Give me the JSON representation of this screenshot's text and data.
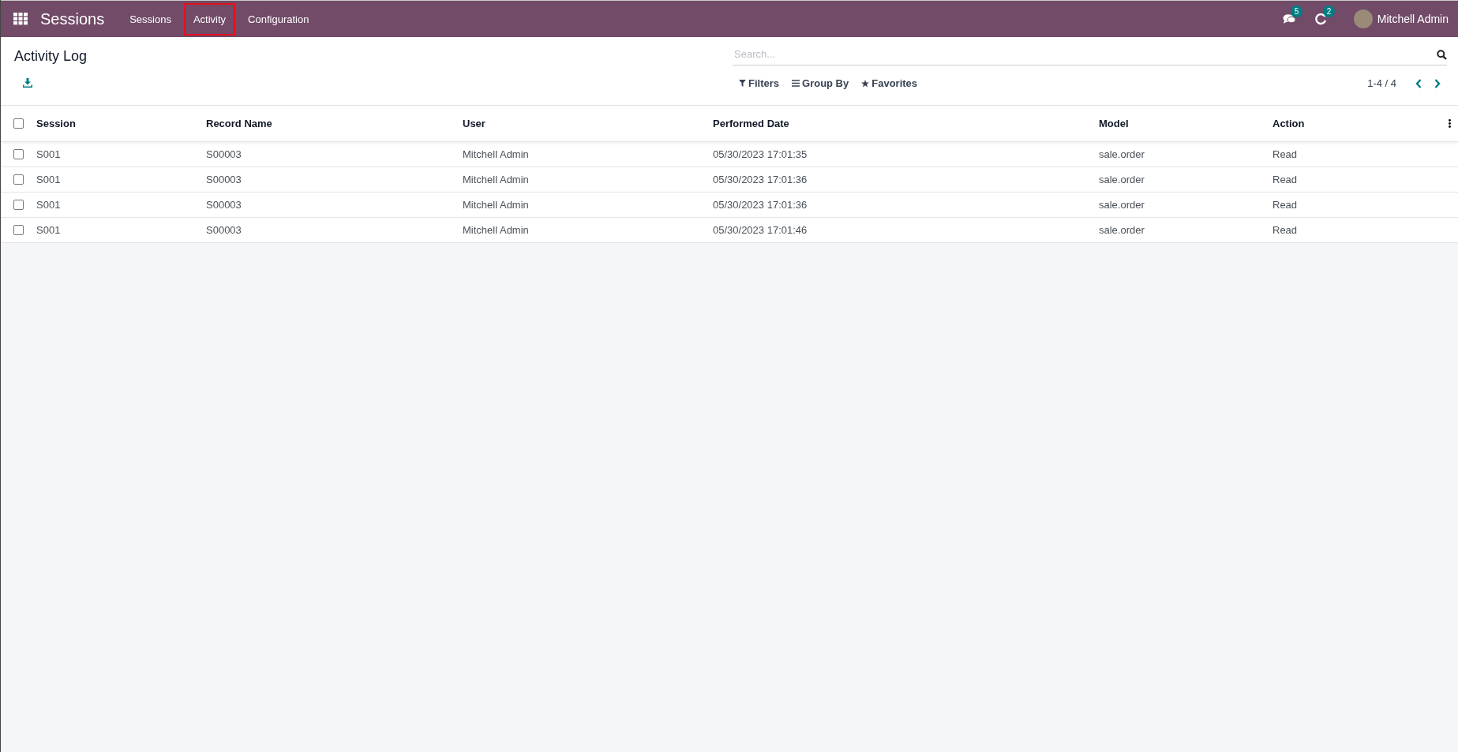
{
  "app_title": "Sessions",
  "menu": [
    {
      "label": "Sessions",
      "highlighted": false
    },
    {
      "label": "Activity",
      "highlighted": true
    },
    {
      "label": "Configuration",
      "highlighted": false
    }
  ],
  "systray": {
    "messages_count": "5",
    "activities_count": "2",
    "user": "Mitchell Admin"
  },
  "page_title": "Activity Log",
  "search": {
    "placeholder": "Search..."
  },
  "filters": [
    {
      "kind": "filter",
      "label": "Filters"
    },
    {
      "kind": "group",
      "label": "Group By"
    },
    {
      "kind": "favorite",
      "label": "Favorites"
    }
  ],
  "pager": "1-4 / 4",
  "table": {
    "all_checked": false,
    "columns": [
      "Session",
      "Record Name",
      "User",
      "Performed Date",
      "Model",
      "Action"
    ],
    "rows": [
      {
        "checked": false,
        "cells": [
          "S001",
          "S00003",
          "Mitchell Admin",
          "05/30/2023 17:01:35",
          "sale.order",
          "Read"
        ]
      },
      {
        "checked": false,
        "cells": [
          "S001",
          "S00003",
          "Mitchell Admin",
          "05/30/2023 17:01:36",
          "sale.order",
          "Read"
        ]
      },
      {
        "checked": false,
        "cells": [
          "S001",
          "S00003",
          "Mitchell Admin",
          "05/30/2023 17:01:36",
          "sale.order",
          "Read"
        ]
      },
      {
        "checked": false,
        "cells": [
          "S001",
          "S00003",
          "Mitchell Admin",
          "05/30/2023 17:01:46",
          "sale.order",
          "Read"
        ]
      }
    ]
  }
}
